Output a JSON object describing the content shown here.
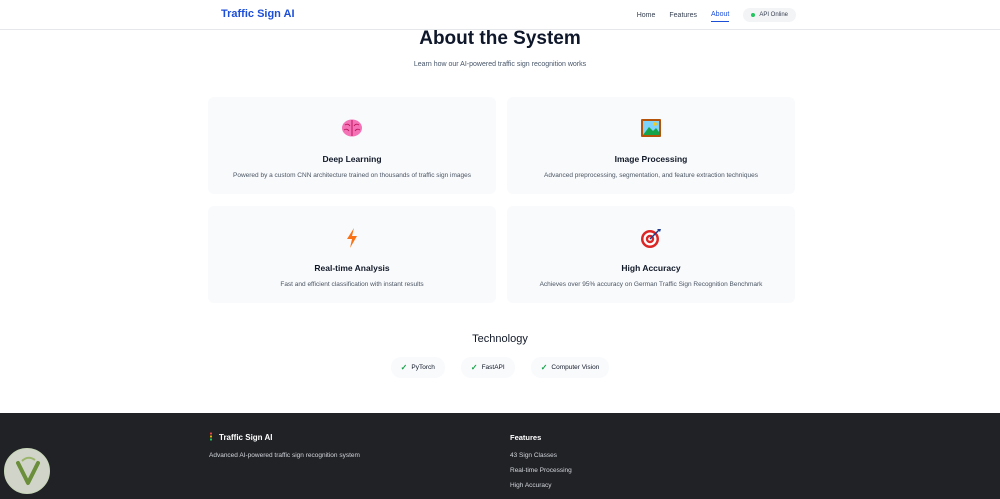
{
  "header": {
    "brand": "Traffic Sign AI",
    "nav": [
      {
        "label": "Home",
        "active": false
      },
      {
        "label": "Features",
        "active": false
      },
      {
        "label": "About",
        "active": true
      }
    ],
    "api_status": "API Online",
    "api_status_color": "#22c55e"
  },
  "hero": {
    "title": "About the System",
    "subtitle": "Learn how our AI-powered traffic sign recognition works"
  },
  "cards": [
    {
      "icon": "brain-icon",
      "title": "Deep Learning",
      "desc": "Powered by a custom CNN architecture trained on thousands of traffic sign images"
    },
    {
      "icon": "picture-icon",
      "title": "Image Processing",
      "desc": "Advanced preprocessing, segmentation, and feature extraction techniques"
    },
    {
      "icon": "lightning-icon",
      "title": "Real-time Analysis",
      "desc": "Fast and efficient classification with instant results"
    },
    {
      "icon": "target-icon",
      "title": "High Accuracy",
      "desc": "Achieves over 95% accuracy on German Traffic Sign Recognition Benchmark"
    }
  ],
  "technology": {
    "title": "Technology",
    "items": [
      "PyTorch",
      "FastAPI",
      "Computer Vision"
    ],
    "check": "✓"
  },
  "footer": {
    "brand": "Traffic Sign AI",
    "desc": "Advanced AI-powered traffic sign recognition system",
    "features_title": "Features",
    "features": [
      "43 Sign Classes",
      "Real-time Processing",
      "High Accuracy"
    ]
  },
  "colors": {
    "accent": "#1d4ed8",
    "footer_bg": "#212226",
    "card_bg": "#f8fafc"
  }
}
